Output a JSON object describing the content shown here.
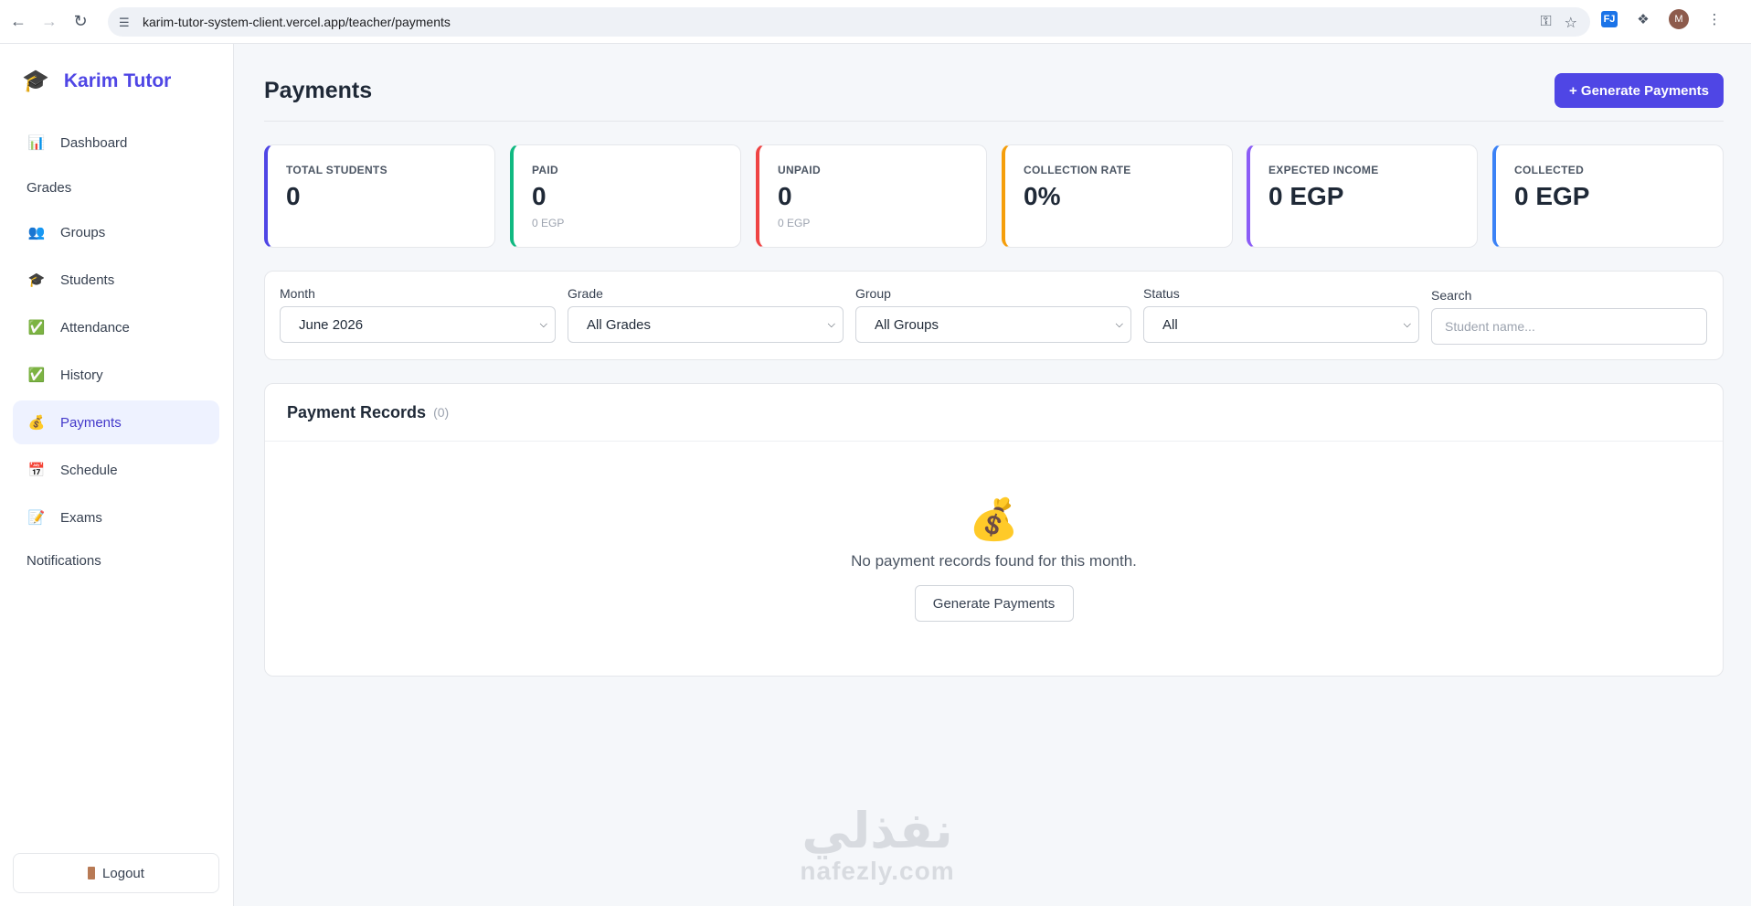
{
  "browser": {
    "url": "karim-tutor-system-client.vercel.app/teacher/payments",
    "avatar_initial": "M",
    "ext_label": "FJ"
  },
  "brand": {
    "name": "Karim Tutor"
  },
  "sidebar": {
    "items": [
      {
        "label": "Dashboard",
        "icon": "bar-chart-icon"
      },
      {
        "label": "Grades",
        "icon": null
      },
      {
        "label": "Groups",
        "icon": "people-icon"
      },
      {
        "label": "Students",
        "icon": "graduation-cap-icon"
      },
      {
        "label": "Attendance",
        "icon": "check-icon"
      },
      {
        "label": "History",
        "icon": "check-icon"
      },
      {
        "label": "Payments",
        "icon": "money-bag-icon",
        "active": true
      },
      {
        "label": "Schedule",
        "icon": "calendar-icon"
      },
      {
        "label": "Exams",
        "icon": "memo-icon"
      },
      {
        "label": "Notifications",
        "icon": null
      }
    ],
    "logout_label": "Logout"
  },
  "header": {
    "title": "Payments",
    "generate_button": "+ Generate Payments"
  },
  "stats": [
    {
      "label": "TOTAL STUDENTS",
      "value": "0",
      "sub": "",
      "color": "#4f46e5"
    },
    {
      "label": "PAID",
      "value": "0",
      "sub": "0 EGP",
      "color": "#10b981"
    },
    {
      "label": "UNPAID",
      "value": "0",
      "sub": "0 EGP",
      "color": "#ef4444"
    },
    {
      "label": "COLLECTION RATE",
      "value": "0%",
      "sub": "",
      "color": "#f59e0b"
    },
    {
      "label": "EXPECTED INCOME",
      "value": "0 EGP",
      "sub": "",
      "color": "#8b5cf6"
    },
    {
      "label": "COLLECTED",
      "value": "0 EGP",
      "sub": "",
      "color": "#3b82f6"
    }
  ],
  "filters": {
    "month": {
      "label": "Month",
      "value": "June 2026"
    },
    "grade": {
      "label": "Grade",
      "value": "All Grades"
    },
    "group": {
      "label": "Group",
      "value": "All Groups"
    },
    "status": {
      "label": "Status",
      "value": "All"
    },
    "search": {
      "label": "Search",
      "placeholder": "Student name..."
    }
  },
  "records": {
    "title": "Payment Records",
    "count": "(0)",
    "empty_text": "No payment records found for this month.",
    "empty_button": "Generate Payments"
  },
  "watermark": {
    "arabic": "نفذلي",
    "latin": "nafezly.com"
  }
}
